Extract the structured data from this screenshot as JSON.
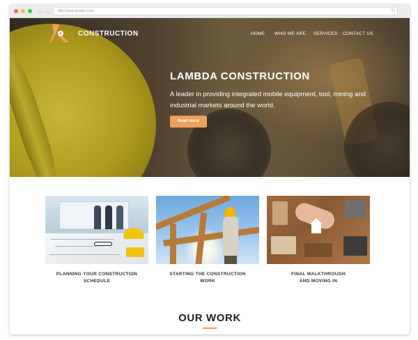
{
  "browser": {
    "url": "http://www.google.com/",
    "back_icon": "←",
    "forward_icon": "→",
    "reload_icon": "↻"
  },
  "header": {
    "logo_text": "CONSTRUCTION",
    "nav": [
      "HOME",
      "WHO WE ARE",
      "SERVICES",
      "CONTACT US"
    ]
  },
  "hero": {
    "title": "LAMBDA CONSTRUCTION",
    "subtitle": "A leader in providing integrated mobile equipment, tool, mining and industrial markets around the world.",
    "button_label": "Read more"
  },
  "cards": [
    {
      "caption_line1": "PLANNING YOUR CONSTRUCTION",
      "caption_line2": "SCHEDULE"
    },
    {
      "caption_line1": "STARTING THE CONSTRUCTION",
      "caption_line2": "WORK"
    },
    {
      "caption_line1": "FINAL WALKTHROUGH",
      "caption_line2": "AND MOVING IN"
    }
  ],
  "section": {
    "title": "OUR WORK"
  },
  "colors": {
    "accent": "#f0a05a",
    "text_dark": "#222222"
  }
}
